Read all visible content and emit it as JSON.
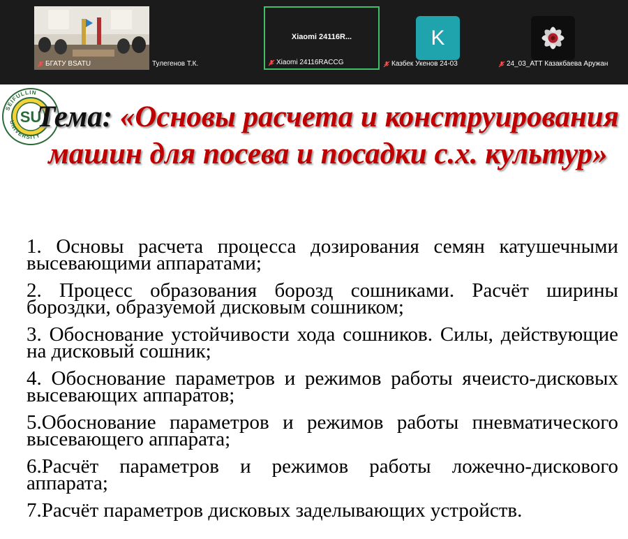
{
  "meeting": {
    "tiles": [
      {
        "name": "БГАТУ BSATU",
        "type": "video"
      },
      {
        "name": "Тулегенов Т.К.",
        "type": "video"
      },
      {
        "name": "Xiaomi 24116RACCG",
        "center_label": "Xiaomi 24116R...",
        "type": "name-only",
        "active": true
      },
      {
        "name": "Казбек Укенов 24-03",
        "initial": "K",
        "avatar_color": "#1fa3ad",
        "type": "avatar"
      },
      {
        "name": "24_03_АТТ Казакбаева Аружан",
        "type": "avatar-image"
      }
    ]
  },
  "slide": {
    "logo_text": "SEIFULLIN UNIVERSITY",
    "title_label": "Тема:",
    "title_text": "«Основы расчета и конструирования машин для посева и посадки с.х. культур»",
    "items": [
      "1. Основы расчета процесса  дозирования семян катушечными  высевающими аппаратами;",
      "2. Процесс образования  борозд сошниками. Расчёт ширины бороздки, образуемой дисковым сошником;",
      "3. Обоснование устойчивости хода сошников. Силы, действующие на дисковый сошник;",
      "4. Обоснование параметров и режимов работы ячеисто-дисковых  высевающих аппаратов;",
      "5.Обоснование параметров и режимов работы пневматического высевающего аппарата;",
      "6.Расчёт параметров и режимов работы ложечно-дискового аппарата;",
      "7.Расчёт параметров дисковых заделывающих  устройств."
    ]
  },
  "colors": {
    "title_red": "#c00000",
    "active_border": "#3fbf69",
    "strip_bg": "#1b1b1b"
  }
}
